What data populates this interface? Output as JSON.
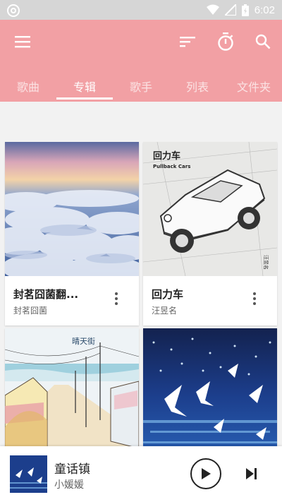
{
  "status_bar": {
    "time": "6:02"
  },
  "tabs": [
    {
      "label": "歌曲"
    },
    {
      "label": "专辑"
    },
    {
      "label": "歌手"
    },
    {
      "label": "列表"
    },
    {
      "label": "文件夹"
    }
  ],
  "active_tab": "专辑",
  "albums": [
    {
      "title": "封茗囧菌翻...",
      "artist": "封茗囧菌"
    },
    {
      "title": "回力车",
      "artist": "汪昱名"
    },
    {
      "title": "",
      "artist": ""
    },
    {
      "title": "",
      "artist": ""
    }
  ],
  "album_cover_texts": {
    "car_logo": "回力车",
    "car_subtitle": "Pullback Cars",
    "street_title": "晴天街"
  },
  "now_playing": {
    "title": "童话镇",
    "artist": "小媛媛"
  },
  "colors": {
    "accent": "#f2a0a4",
    "background": "#f2f2f2"
  },
  "icons": [
    "menu-icon",
    "sort-icon",
    "timer-icon",
    "search-icon",
    "more-vert-icon",
    "play-icon",
    "skip-next-icon",
    "wifi-icon",
    "signal-icon",
    "battery-icon"
  ]
}
